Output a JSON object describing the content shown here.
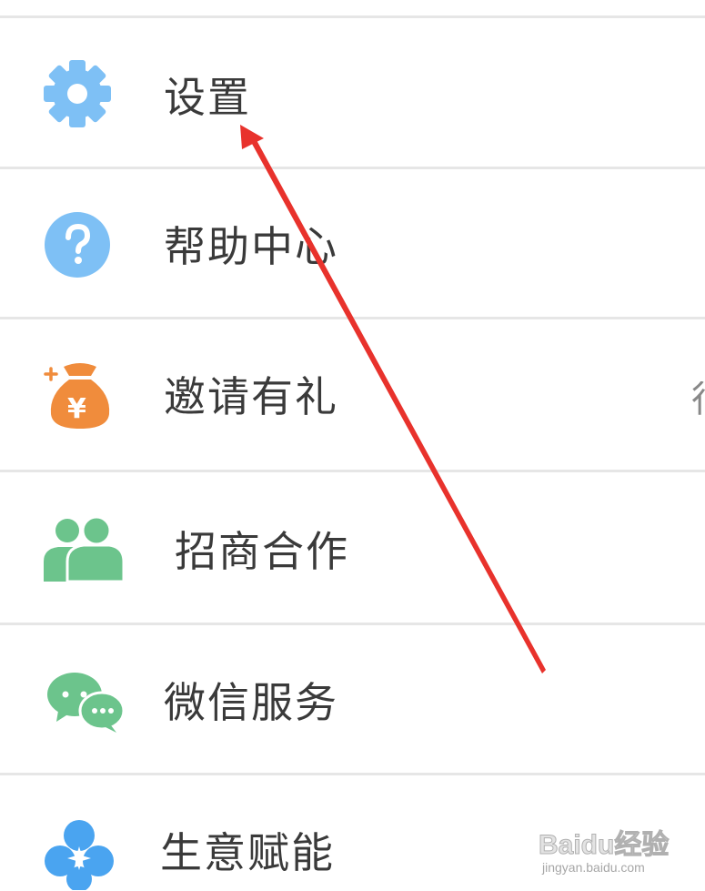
{
  "menu": {
    "items": [
      {
        "label": "设置",
        "icon": "gear-icon",
        "color": "#7ec0f5"
      },
      {
        "label": "帮助中心",
        "icon": "help-icon",
        "color": "#7ec0f5"
      },
      {
        "label": "邀请有礼",
        "icon": "money-bag-icon",
        "color": "#f08c3c",
        "symbol": "¥",
        "trailing": "行"
      },
      {
        "label": "招商合作",
        "icon": "people-icon",
        "color": "#6cc48c"
      },
      {
        "label": "微信服务",
        "icon": "wechat-icon",
        "color": "#6cc48c"
      },
      {
        "label": "生意赋能",
        "icon": "flower-icon",
        "color": "#4aa4f0"
      }
    ]
  },
  "watermark": {
    "brand": "Baidu经验",
    "url": "jingyan.baidu.com"
  },
  "annotation": {
    "arrow_color": "#e8322c"
  }
}
